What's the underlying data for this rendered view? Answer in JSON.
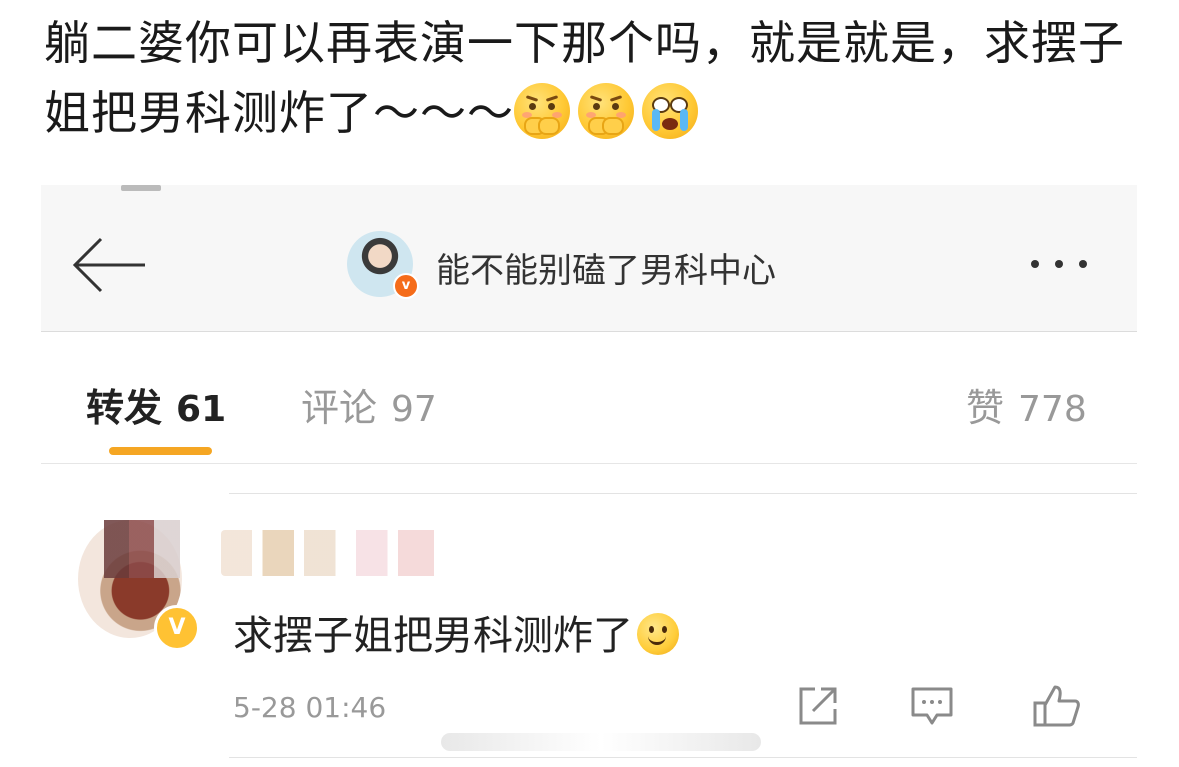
{
  "post": {
    "text": "躺二婆你可以再表演一下那个吗，就是就是，求摆子姐把男科测炸了～～～",
    "emojis": [
      "shy-face-emoji",
      "shy-face-emoji",
      "crying-face-emoji"
    ]
  },
  "nav": {
    "title": "能不能别磕了男科中心",
    "back_icon": "arrow-left-icon",
    "more_icon": "more-dots-icon",
    "avatar_badge": "v"
  },
  "tabs": {
    "repost_label": "转发",
    "repost_count": "61",
    "comment_label": "评论",
    "comment_count": "97",
    "like_label": "赞",
    "like_count": "778",
    "active_color": "#f5a623"
  },
  "comment": {
    "text": "求摆子姐把男科测炸了",
    "emoji": "smile-emoji",
    "timestamp": "5-28 01:46",
    "verified_badge": "V",
    "actions": [
      "share-icon",
      "comment-icon",
      "thumbs-up-icon"
    ]
  },
  "colors": {
    "accent": "#f5a623",
    "verified": "#ffc233",
    "nav_badge": "#f56c1a"
  }
}
